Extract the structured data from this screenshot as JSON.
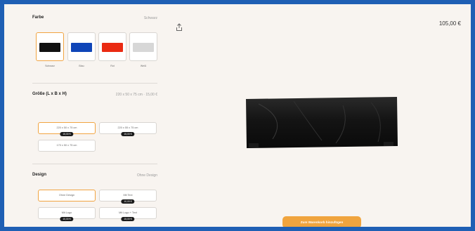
{
  "color": {
    "title": "Farbe",
    "selected_value": "Schwarz",
    "options": [
      {
        "label": "Schwarz",
        "swatch": "#111111",
        "selected": true
      },
      {
        "label": "Blau",
        "swatch": "#0f45b8",
        "selected": false
      },
      {
        "label": "Rot",
        "swatch": "#ea2a12",
        "selected": false
      },
      {
        "label": "Weiß",
        "swatch": "#d7d7d7",
        "selected": false
      }
    ]
  },
  "size": {
    "title": "Größe (L x B x H)",
    "selected_value": "220 x 50 x 75 cm · 15,00 €",
    "options": [
      {
        "label": "220 x 50 x 75 cm",
        "price": "15,00 €",
        "selected": true
      },
      {
        "label": "220 x 55 x 75 cm",
        "price": "15,00 €",
        "selected": false
      },
      {
        "label": "170 x 50 x 75 cm",
        "price": "",
        "selected": false
      }
    ]
  },
  "design": {
    "title": "Design",
    "selected_value": "Ohne Design",
    "options": [
      {
        "label": "Ohne Design",
        "price": "",
        "selected": true
      },
      {
        "label": "Mit Text",
        "price": "10,00 €",
        "selected": false
      },
      {
        "label": "Mit Logo",
        "price": "10,00 €",
        "selected": false
      },
      {
        "label": "Mit Logo + Text",
        "price": "15,00 €",
        "selected": false
      }
    ]
  },
  "product": {
    "price": "105,00 €",
    "share_icon": "share-icon",
    "cta_label": "Zum Warenkorb hinzufügen"
  },
  "colors": {
    "accent": "#f0a43e",
    "frame": "#1f5fb4",
    "background": "#f8f4f0"
  }
}
